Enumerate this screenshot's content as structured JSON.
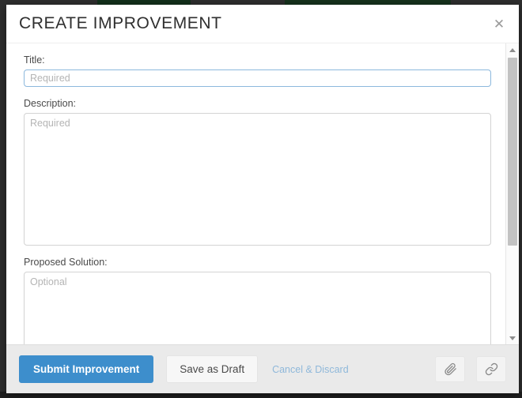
{
  "modal": {
    "title": "CREATE IMPROVEMENT",
    "close_icon": "close-icon",
    "accent_color": "#3d8ecc",
    "link_color": "#8fb8da",
    "footer_bg": "#eaeaea"
  },
  "form": {
    "title_field": {
      "label": "Title:",
      "placeholder": "Required",
      "value": ""
    },
    "description_field": {
      "label": "Description:",
      "placeholder": "Required",
      "value": ""
    },
    "solution_field": {
      "label": "Proposed Solution:",
      "placeholder": "Optional",
      "value": ""
    }
  },
  "footer": {
    "submit_label": "Submit Improvement",
    "draft_label": "Save as Draft",
    "cancel_label": "Cancel & Discard",
    "attach_icon": "paperclip-icon",
    "link_icon": "chain-link-icon"
  },
  "scrollbar": {
    "up_icon": "chevron-up-icon",
    "down_icon": "chevron-down-icon"
  }
}
